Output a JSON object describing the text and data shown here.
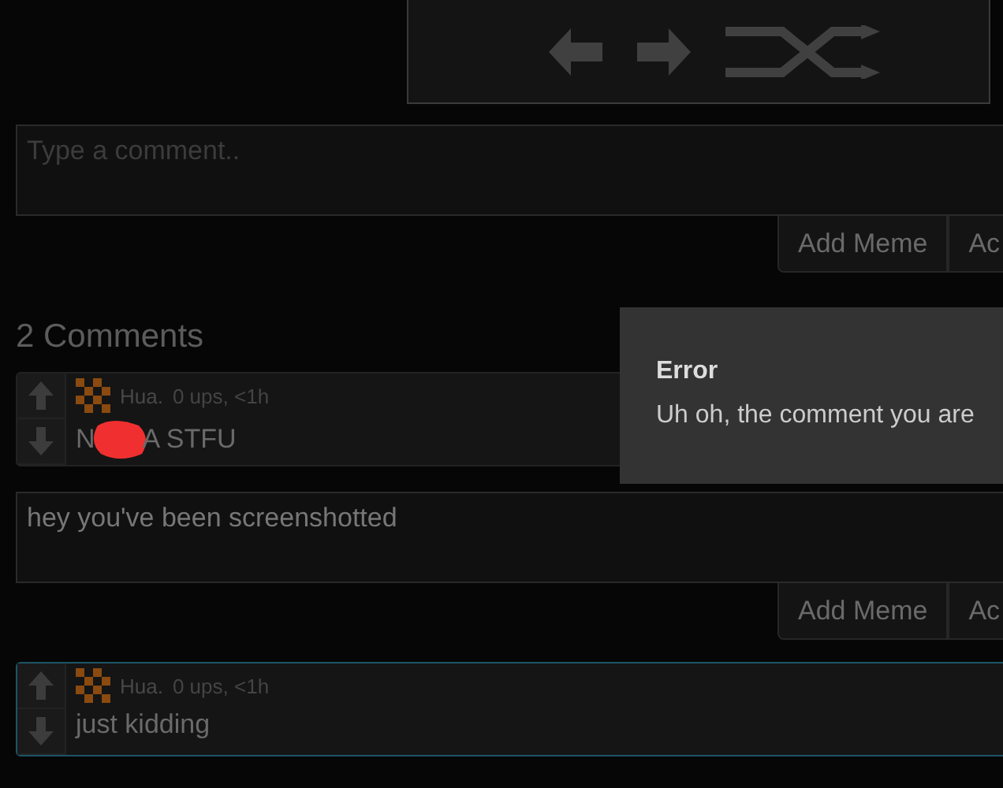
{
  "navigation": {
    "buttons": [
      {
        "kind": "previous"
      },
      {
        "kind": "next"
      },
      {
        "kind": "random"
      }
    ]
  },
  "comment_form": {
    "placeholder": "Type a comment..",
    "buttons": [
      "Add Meme",
      "Ac"
    ]
  },
  "comments_heading": "2 Comments",
  "comments": [
    {
      "user": "Hua.",
      "meta": "0 ups, <1h",
      "text": "N",
      "text_after_censor": "A STFU",
      "censored": true,
      "highlighted": false,
      "reply": {
        "value": "hey you've been screenshotted",
        "buttons": [
          "Add Meme",
          "Ac"
        ]
      }
    },
    {
      "user": "Hua.",
      "meta": "0 ups, <1h",
      "text": "just kidding",
      "censored": false,
      "highlighted": true
    }
  ],
  "error_dialog": {
    "title": "Error",
    "message": "Uh oh, the comment you are"
  }
}
